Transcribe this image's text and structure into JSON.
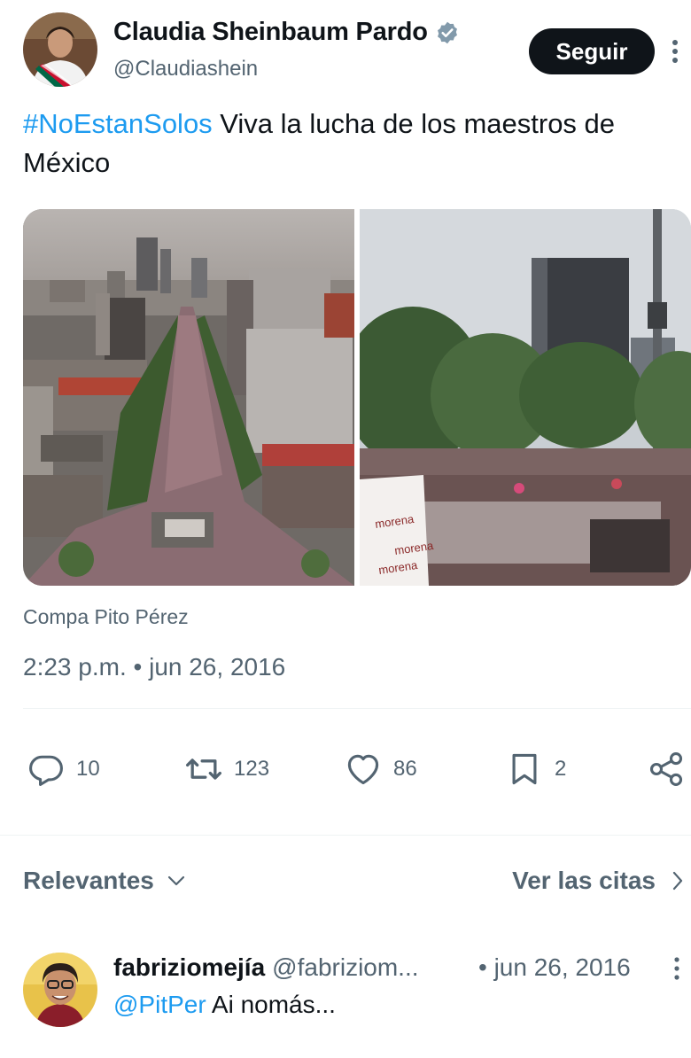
{
  "author": {
    "name": "Claudia Sheinbaum Pardo",
    "handle": "@Claudiashein",
    "follow_label": "Seguir"
  },
  "tweet": {
    "hashtag": "#NoEstanSolos",
    "text": " Viva la lucha de los maestros de México",
    "media_caption": "Compa Pito Pérez",
    "timestamp": "2:23 p.m. • jun 26, 2016"
  },
  "banner_texts": [
    "morena",
    "morena",
    "morena"
  ],
  "actions": {
    "replies": "10",
    "retweets": "123",
    "likes": "86",
    "bookmarks": "2"
  },
  "replies_header": {
    "sort_label": "Relevantes",
    "quotes_label": "Ver las citas"
  },
  "reply": {
    "name": "fabriziomejía",
    "handle": "@fabriziom...",
    "date": "• jun 26, 2016",
    "mention": "@PitPer",
    "text": " Ai nomás..."
  },
  "colors": {
    "accent": "#1d9bf0",
    "muted": "#536471",
    "text": "#0f1419",
    "button_bg": "#0f1419"
  },
  "icons": [
    "verified-badge-icon",
    "more-vertical-icon",
    "reply-icon",
    "retweet-icon",
    "like-icon",
    "bookmark-icon",
    "share-icon",
    "chevron-down-icon",
    "chevron-right-icon"
  ]
}
